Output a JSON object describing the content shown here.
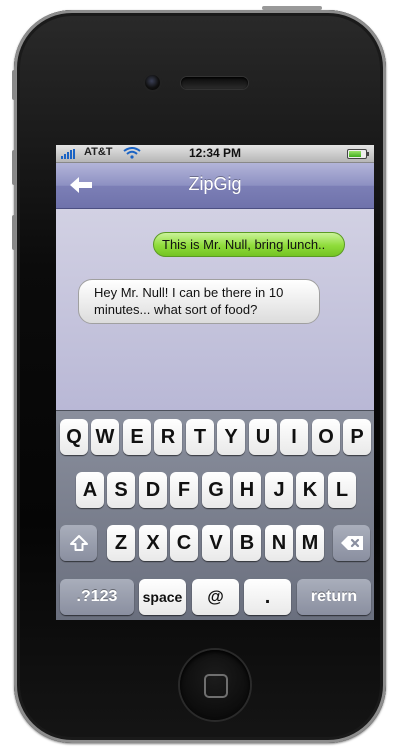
{
  "status": {
    "carrier": "AT&T",
    "time": "12:34 PM",
    "battery_level": 0.75,
    "signal_color": "#1a63c4"
  },
  "navbar": {
    "title": "ZipGig",
    "back_icon": "back-arrow-icon",
    "color": "#7c7fb6"
  },
  "messages": [
    {
      "direction": "outgoing",
      "text": "This is Mr. Null, bring lunch..",
      "color": "#8fdc3a"
    },
    {
      "direction": "incoming",
      "line1": "Hey Mr. Null!  I can be there in 10",
      "line2": "minutes... what sort of food?"
    }
  ],
  "keyboard": {
    "row1": [
      "Q",
      "W",
      "E",
      "R",
      "T",
      "Y",
      "U",
      "I",
      "O",
      "P"
    ],
    "row2": [
      "A",
      "S",
      "D",
      "F",
      "G",
      "H",
      "J",
      "K",
      "L"
    ],
    "row3": [
      "Z",
      "X",
      "C",
      "V",
      "B",
      "N",
      "M"
    ],
    "shift_icon": "shift-icon",
    "delete_icon": "delete-icon",
    "mode_key": ".?123",
    "space_key": "space",
    "at_key": "@",
    "period_key": ".",
    "return_key": "return"
  }
}
